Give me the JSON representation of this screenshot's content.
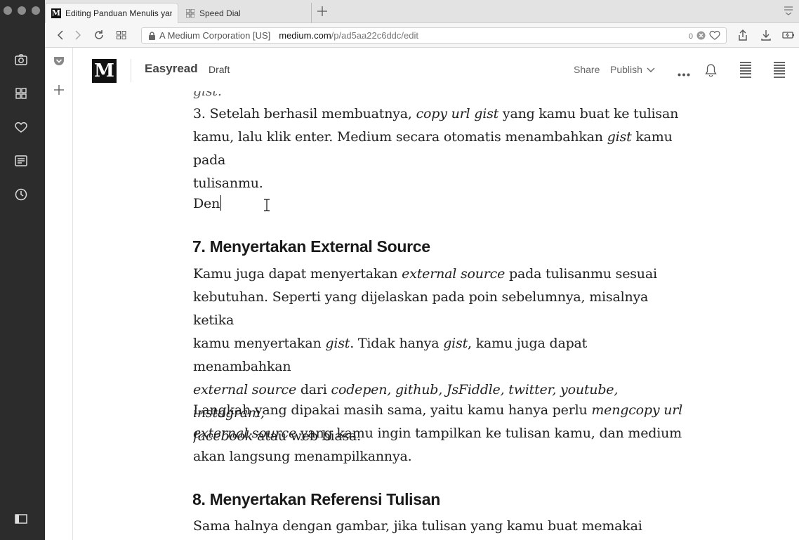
{
  "browser": {
    "tabs": [
      {
        "label": "Editing Panduan Menulis yang",
        "active": true,
        "icon": "medium-favicon"
      },
      {
        "label": "Speed Dial",
        "active": false,
        "icon": "speed-dial-icon"
      }
    ],
    "address": {
      "certificate": "A Medium Corporation [US]",
      "host": "medium.com",
      "path": "/p/ad5aa22c6ddc/edit",
      "blocked_count": "0"
    }
  },
  "sidebar": {
    "items": [
      "camera-icon",
      "speed-dial-icon",
      "heart-icon",
      "news-icon",
      "history-icon"
    ],
    "bottom": "sidebar-toggle-icon"
  },
  "header": {
    "logo": "M",
    "publication": "Easyread",
    "status": "Draft",
    "share_label": "Share",
    "publish_label": "Publish"
  },
  "article": {
    "cut_top": "gist.",
    "step3_line1_a": "3. Setelah berhasil membuatnya, ",
    "step3_line1_b": "copy url gist",
    "step3_line1_c": " yang kamu buat ke tulisan",
    "step3_line2_a": "kamu, lalu klik enter. Medium secara otomatis menambahkan ",
    "step3_line2_b": "gist",
    "step3_line2_c": " kamu pada",
    "step3_line3": "tulisanmu.",
    "typing": "Den",
    "h7": "7. Menyertakan External Source",
    "s7_l1_a": "Kamu juga dapat menyertakan ",
    "s7_l1_b": "external source",
    "s7_l1_c": " pada tulisanmu sesuai",
    "s7_l2": "kebutuhan. Seperti yang dijelaskan pada poin sebelumnya, misalnya ketika",
    "s7_l3_a": "kamu menyertakan ",
    "s7_l3_b": "gist",
    "s7_l3_c": ". Tidak hanya ",
    "s7_l3_d": "gist",
    "s7_l3_e": ", kamu juga dapat menambahkan",
    "s7_l4_a": "external source",
    "s7_l4_b": " dari ",
    "s7_l4_c": "codepen, github, JsFiddle, twitter, youtube, instagram,",
    "s7_l5_a": "facebook",
    "s7_l5_b": " atau web biasa.",
    "s7b_l1_a": "Langkah yang dipakai masih sama, yaitu kamu hanya perlu ",
    "s7b_l1_b": "mengcopy url",
    "s7b_l2_a": "external source",
    "s7b_l2_b": " yang kamu ingin tampilkan ke tulisan kamu, dan medium",
    "s7b_l3": "akan langsung menampilkannya.",
    "h8": "8. Menyertakan Referensi Tulisan",
    "s8_l1": "Sama halnya dengan gambar, jika tulisan yang kamu buat memakai beberapa"
  }
}
